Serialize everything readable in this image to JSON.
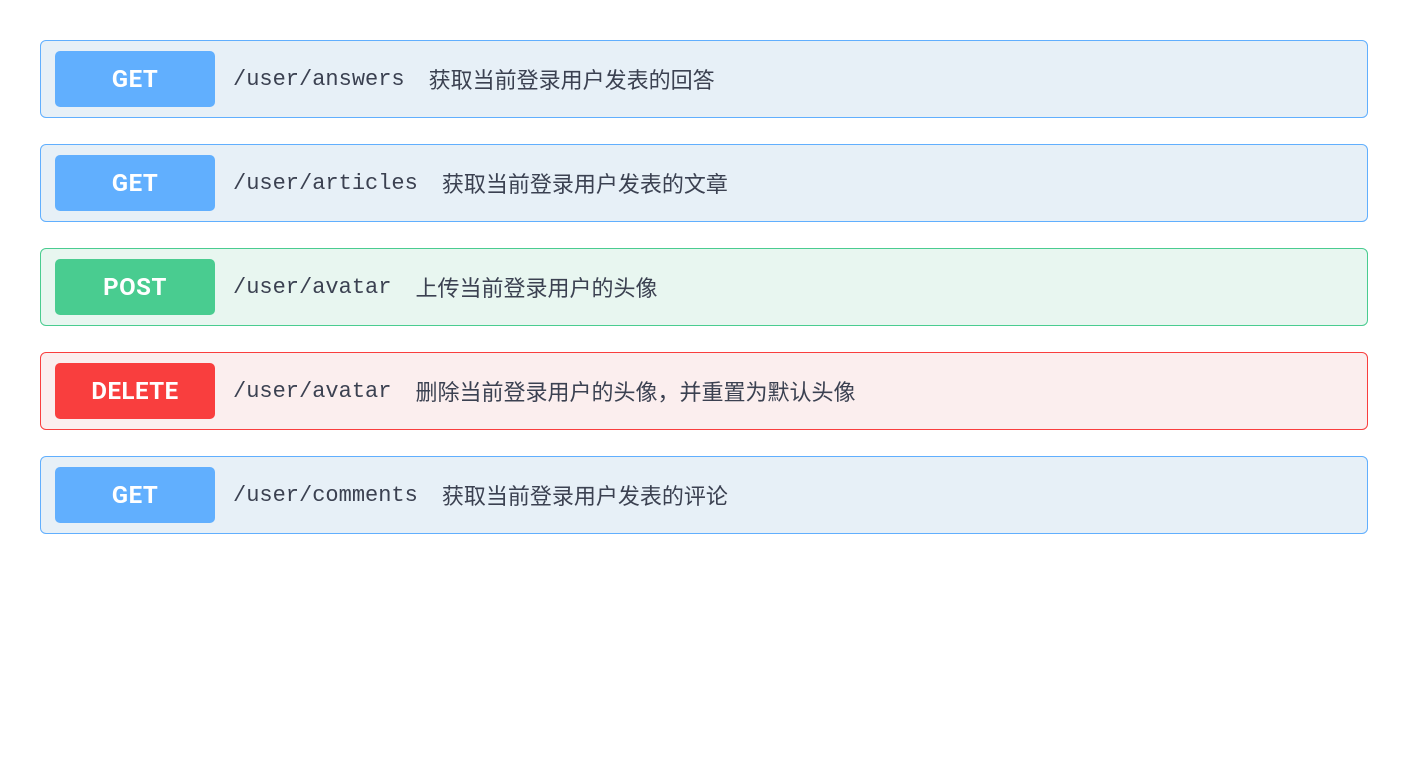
{
  "endpoints": [
    {
      "method": "GET",
      "path": "/user/answers",
      "description": "获取当前登录用户发表的回答",
      "kind": "get"
    },
    {
      "method": "GET",
      "path": "/user/articles",
      "description": "获取当前登录用户发表的文章",
      "kind": "get"
    },
    {
      "method": "POST",
      "path": "/user/avatar",
      "description": "上传当前登录用户的头像",
      "kind": "post"
    },
    {
      "method": "DELETE",
      "path": "/user/avatar",
      "description": "删除当前登录用户的头像，并重置为默认头像",
      "kind": "delete"
    },
    {
      "method": "GET",
      "path": "/user/comments",
      "description": "获取当前登录用户发表的评论",
      "kind": "get"
    }
  ]
}
